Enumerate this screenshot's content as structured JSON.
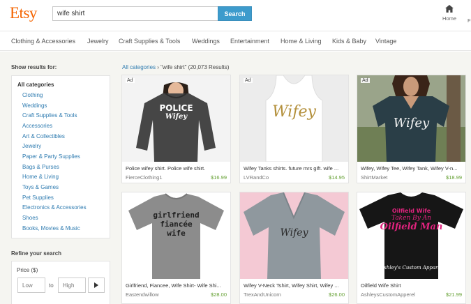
{
  "brand": {
    "logo": "Etsy",
    "color": "#f56400"
  },
  "search": {
    "value": "wife shirt",
    "button_label": "Search"
  },
  "header": {
    "home_label": "Home",
    "clipped_label": "F"
  },
  "nav": {
    "items": [
      "Clothing & Accessories",
      "Jewelry",
      "Craft Supplies & Tools",
      "Weddings",
      "Entertainment",
      "Home & Living",
      "Kids & Baby",
      "Vintage"
    ]
  },
  "sidebar": {
    "show_results_heading": "Show results for:",
    "all_categories": "All categories",
    "categories": [
      "Clothing",
      "Weddings",
      "Craft Supplies & Tools",
      "Accessories",
      "Art & Collectibles",
      "Jewelry",
      "Paper & Party Supplies",
      "Bags & Purses",
      "Home & Living",
      "Toys & Games",
      "Pet Supplies",
      "Electronics & Accessories",
      "Shoes",
      "Books, Movies & Music"
    ],
    "refine_heading": "Refine your search",
    "price_label": "Price ($)",
    "price_low_placeholder": "Low",
    "price_to": "to",
    "price_high_placeholder": "High"
  },
  "breadcrumb": {
    "link": "All categories",
    "separator": "›",
    "query": "\"wife shirt\"",
    "count": "(20,073 Results)"
  },
  "listings": [
    {
      "ad": "Ad",
      "title": "Police wifey shirt. Police wife shirt.",
      "shop": "FierceClothing1",
      "price": "$16.99",
      "print_lines": [
        "POLICE",
        "Wifey"
      ]
    },
    {
      "ad": "Ad",
      "title": "Wifey Tanks shirts. future mrs gift. wife ...",
      "shop": "LVRandCo",
      "price": "$14.95",
      "print_lines": [
        "Wifey"
      ]
    },
    {
      "ad": "Ad",
      "title": "Wifey, Wifey Tee, Wifey Tank, Wifey V-n...",
      "shop": "ShirtMarket",
      "price": "$18.99",
      "print_lines": [
        "Wifey"
      ]
    },
    {
      "ad": "",
      "title": "Girlfriend, Fiancee, Wife Shirt- Wife Shi...",
      "shop": "Eastendwillow",
      "price": "$28.00",
      "print_lines": [
        "girlfriend",
        "fiancée",
        "wife"
      ]
    },
    {
      "ad": "",
      "title": "Wifey V-Neck Tshirt, Wifey Shirt, Wifey ...",
      "shop": "TrexAndUnicorn",
      "price": "$26.00",
      "print_lines": [
        "Wifey"
      ]
    },
    {
      "ad": "",
      "title": "Oilfield Wife Shirt",
      "shop": "AshleysCustomApperel",
      "price": "$21.99",
      "print_lines": [
        "Oilfield Wife",
        "Taken By An",
        "Oilfield Man",
        "Ashley's Custom Apparel"
      ]
    }
  ]
}
